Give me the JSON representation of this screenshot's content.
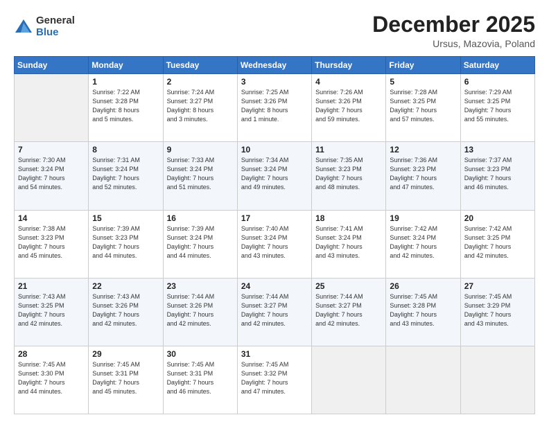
{
  "logo": {
    "general": "General",
    "blue": "Blue"
  },
  "header": {
    "month": "December 2025",
    "location": "Ursus, Mazovia, Poland"
  },
  "days_of_week": [
    "Sunday",
    "Monday",
    "Tuesday",
    "Wednesday",
    "Thursday",
    "Friday",
    "Saturday"
  ],
  "weeks": [
    [
      {
        "day": "",
        "info": ""
      },
      {
        "day": "1",
        "info": "Sunrise: 7:22 AM\nSunset: 3:28 PM\nDaylight: 8 hours\nand 5 minutes."
      },
      {
        "day": "2",
        "info": "Sunrise: 7:24 AM\nSunset: 3:27 PM\nDaylight: 8 hours\nand 3 minutes."
      },
      {
        "day": "3",
        "info": "Sunrise: 7:25 AM\nSunset: 3:26 PM\nDaylight: 8 hours\nand 1 minute."
      },
      {
        "day": "4",
        "info": "Sunrise: 7:26 AM\nSunset: 3:26 PM\nDaylight: 7 hours\nand 59 minutes."
      },
      {
        "day": "5",
        "info": "Sunrise: 7:28 AM\nSunset: 3:25 PM\nDaylight: 7 hours\nand 57 minutes."
      },
      {
        "day": "6",
        "info": "Sunrise: 7:29 AM\nSunset: 3:25 PM\nDaylight: 7 hours\nand 55 minutes."
      }
    ],
    [
      {
        "day": "7",
        "info": "Sunrise: 7:30 AM\nSunset: 3:24 PM\nDaylight: 7 hours\nand 54 minutes."
      },
      {
        "day": "8",
        "info": "Sunrise: 7:31 AM\nSunset: 3:24 PM\nDaylight: 7 hours\nand 52 minutes."
      },
      {
        "day": "9",
        "info": "Sunrise: 7:33 AM\nSunset: 3:24 PM\nDaylight: 7 hours\nand 51 minutes."
      },
      {
        "day": "10",
        "info": "Sunrise: 7:34 AM\nSunset: 3:24 PM\nDaylight: 7 hours\nand 49 minutes."
      },
      {
        "day": "11",
        "info": "Sunrise: 7:35 AM\nSunset: 3:23 PM\nDaylight: 7 hours\nand 48 minutes."
      },
      {
        "day": "12",
        "info": "Sunrise: 7:36 AM\nSunset: 3:23 PM\nDaylight: 7 hours\nand 47 minutes."
      },
      {
        "day": "13",
        "info": "Sunrise: 7:37 AM\nSunset: 3:23 PM\nDaylight: 7 hours\nand 46 minutes."
      }
    ],
    [
      {
        "day": "14",
        "info": "Sunrise: 7:38 AM\nSunset: 3:23 PM\nDaylight: 7 hours\nand 45 minutes."
      },
      {
        "day": "15",
        "info": "Sunrise: 7:39 AM\nSunset: 3:23 PM\nDaylight: 7 hours\nand 44 minutes."
      },
      {
        "day": "16",
        "info": "Sunrise: 7:39 AM\nSunset: 3:24 PM\nDaylight: 7 hours\nand 44 minutes."
      },
      {
        "day": "17",
        "info": "Sunrise: 7:40 AM\nSunset: 3:24 PM\nDaylight: 7 hours\nand 43 minutes."
      },
      {
        "day": "18",
        "info": "Sunrise: 7:41 AM\nSunset: 3:24 PM\nDaylight: 7 hours\nand 43 minutes."
      },
      {
        "day": "19",
        "info": "Sunrise: 7:42 AM\nSunset: 3:24 PM\nDaylight: 7 hours\nand 42 minutes."
      },
      {
        "day": "20",
        "info": "Sunrise: 7:42 AM\nSunset: 3:25 PM\nDaylight: 7 hours\nand 42 minutes."
      }
    ],
    [
      {
        "day": "21",
        "info": "Sunrise: 7:43 AM\nSunset: 3:25 PM\nDaylight: 7 hours\nand 42 minutes."
      },
      {
        "day": "22",
        "info": "Sunrise: 7:43 AM\nSunset: 3:26 PM\nDaylight: 7 hours\nand 42 minutes."
      },
      {
        "day": "23",
        "info": "Sunrise: 7:44 AM\nSunset: 3:26 PM\nDaylight: 7 hours\nand 42 minutes."
      },
      {
        "day": "24",
        "info": "Sunrise: 7:44 AM\nSunset: 3:27 PM\nDaylight: 7 hours\nand 42 minutes."
      },
      {
        "day": "25",
        "info": "Sunrise: 7:44 AM\nSunset: 3:27 PM\nDaylight: 7 hours\nand 42 minutes."
      },
      {
        "day": "26",
        "info": "Sunrise: 7:45 AM\nSunset: 3:28 PM\nDaylight: 7 hours\nand 43 minutes."
      },
      {
        "day": "27",
        "info": "Sunrise: 7:45 AM\nSunset: 3:29 PM\nDaylight: 7 hours\nand 43 minutes."
      }
    ],
    [
      {
        "day": "28",
        "info": "Sunrise: 7:45 AM\nSunset: 3:30 PM\nDaylight: 7 hours\nand 44 minutes."
      },
      {
        "day": "29",
        "info": "Sunrise: 7:45 AM\nSunset: 3:31 PM\nDaylight: 7 hours\nand 45 minutes."
      },
      {
        "day": "30",
        "info": "Sunrise: 7:45 AM\nSunset: 3:31 PM\nDaylight: 7 hours\nand 46 minutes."
      },
      {
        "day": "31",
        "info": "Sunrise: 7:45 AM\nSunset: 3:32 PM\nDaylight: 7 hours\nand 47 minutes."
      },
      {
        "day": "",
        "info": ""
      },
      {
        "day": "",
        "info": ""
      },
      {
        "day": "",
        "info": ""
      }
    ]
  ]
}
